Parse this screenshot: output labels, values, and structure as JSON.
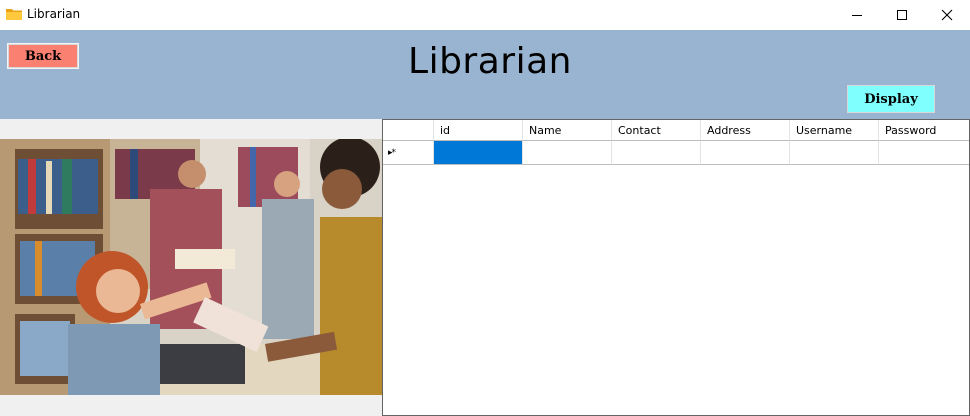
{
  "window": {
    "title": "Librarian",
    "icon": "folder-icon",
    "controls": [
      "minimize-icon",
      "maximize-icon",
      "close-icon"
    ]
  },
  "header": {
    "title": "Librarian",
    "back_label": "Back",
    "display_label": "Display",
    "background": "#99b4d1",
    "back_color": "#fa8072",
    "display_color": "#80ffff"
  },
  "grid": {
    "columns": [
      "id",
      "Name",
      "Contact",
      "Address",
      "Username",
      "Password"
    ],
    "new_row_indicator": "▸*",
    "rows": [],
    "selected_color": "#0078d7"
  }
}
